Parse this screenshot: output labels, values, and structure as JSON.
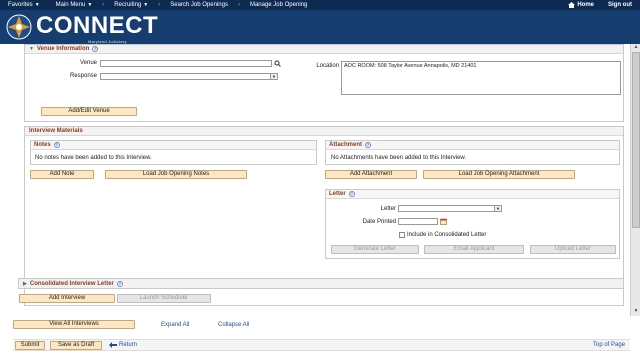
{
  "topnav": {
    "favorites": "Favorites",
    "main_menu": "Main Menu",
    "breadcrumbs": [
      "Recruiting",
      "Search Job Openings",
      "Manage Job Opening"
    ],
    "home": "Home",
    "sign_out": "Sign out"
  },
  "header": {
    "brand": "CONNECT",
    "tagline": "Maryland Judiciary"
  },
  "venue": {
    "title": "Venue Information",
    "venue_label": "Venue",
    "venue_value": "",
    "response_label": "Response",
    "response_value": "",
    "location_label": "Location",
    "location_value": "AOC ROOM: 508 Taylor Avenue Annapolis, MD 21401",
    "add_edit_button": "Add/Edit Venue"
  },
  "materials": {
    "title": "Interview Materials",
    "notes_title": "Notes",
    "notes_empty": "No notes have been added to this Interview.",
    "add_note_button": "Add Note",
    "load_notes_button": "Load Job Opening Notes",
    "attachment_title": "Attachment",
    "attachment_empty": "No Attachments have been added to this Interview.",
    "add_attachment_button": "Add Attachment",
    "load_attachment_button": "Load Job Opening Attachment"
  },
  "letter": {
    "title": "Letter",
    "letter_label": "Letter",
    "letter_value": "",
    "date_label": "Date Printed",
    "date_value": "",
    "consolidated_label": "Include in Consolidated Letter",
    "consolidated_checked": false,
    "generate_button": "Generate Letter",
    "email_button": "Email Applicant",
    "upload_button": "Upload Letter"
  },
  "consolidated": {
    "title": "Consolidated Interview Letter"
  },
  "actions": {
    "add_interview": "Add Interview",
    "launch_scheduler": "Launch Scheduler"
  },
  "footer": {
    "view_all": "View All Interviews",
    "expand_all": "Expand All",
    "collapse_all": "Collapse All",
    "submit": "Submit",
    "save_draft": "Save as Draft",
    "return": "Return",
    "top_of_page": "Top of Page"
  },
  "colors": {
    "nav_bg": "#0d2b52",
    "header_bg": "#163d6f",
    "section_title": "#8b3a1a",
    "button_bg": "#fbe7c5",
    "link": "#1f4f99"
  }
}
